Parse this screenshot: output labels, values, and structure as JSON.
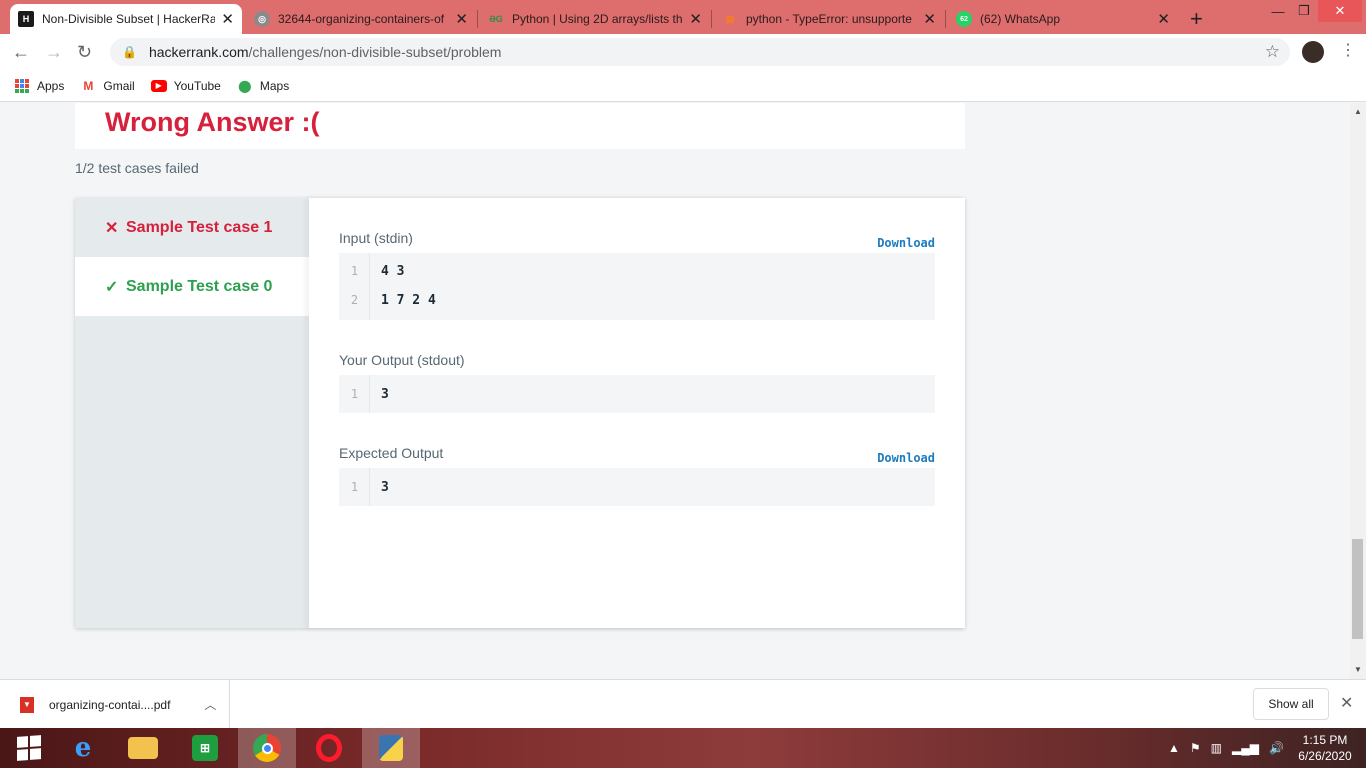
{
  "tabs": [
    {
      "title": "Non-Divisible Subset | HackerRa",
      "favicon": "hackerrank-icon",
      "active": true
    },
    {
      "title": "32644-organizing-containers-of",
      "favicon": "globe-icon",
      "active": false
    },
    {
      "title": "Python | Using 2D arrays/lists th",
      "favicon": "geeksforgeeks-icon",
      "active": false
    },
    {
      "title": "python - TypeError: unsupporte",
      "favicon": "stackoverflow-icon",
      "active": false
    },
    {
      "title": "(62) WhatsApp",
      "favicon": "whatsapp-icon",
      "badge": "62",
      "active": false
    }
  ],
  "address": {
    "domain": "hackerrank.com",
    "path": "/challenges/non-divisible-subset/problem"
  },
  "bookmarks": [
    {
      "label": "Apps",
      "icon": "apps-grid-icon"
    },
    {
      "label": "Gmail",
      "icon": "gmail-icon"
    },
    {
      "label": "YouTube",
      "icon": "youtube-icon"
    },
    {
      "label": "Maps",
      "icon": "maps-pin-icon"
    }
  ],
  "result": {
    "title": "Wrong Answer :(",
    "summary": "1/2 test cases failed"
  },
  "test_cases": [
    {
      "label": "Sample Test case 1",
      "status": "failed"
    },
    {
      "label": "Sample Test case 0",
      "status": "passed"
    }
  ],
  "detail": {
    "input": {
      "label": "Input (stdin)",
      "download": "Download",
      "lines": [
        {
          "n": "1",
          "text": "4 3"
        },
        {
          "n": "2",
          "text": "1 7 2 4"
        }
      ]
    },
    "output": {
      "label": "Your Output (stdout)",
      "lines": [
        {
          "n": "1",
          "text": "3"
        }
      ]
    },
    "expected": {
      "label": "Expected Output",
      "download": "Download",
      "lines": [
        {
          "n": "1",
          "text": "3"
        }
      ]
    }
  },
  "download_shelf": {
    "file": "organizing-contai....pdf",
    "show_all": "Show all"
  },
  "taskbar": {
    "apps": [
      "start-button",
      "internet-explorer-icon",
      "file-explorer-icon",
      "store-icon",
      "chrome-icon",
      "opera-icon",
      "python-idle-icon"
    ],
    "time": "1:15 PM",
    "date": "6/26/2020"
  },
  "colors": {
    "tab_bar": "#de6d6e",
    "fail_red": "#d6203c",
    "pass_green": "#2ea04f",
    "link_blue": "#1c7cc0"
  }
}
